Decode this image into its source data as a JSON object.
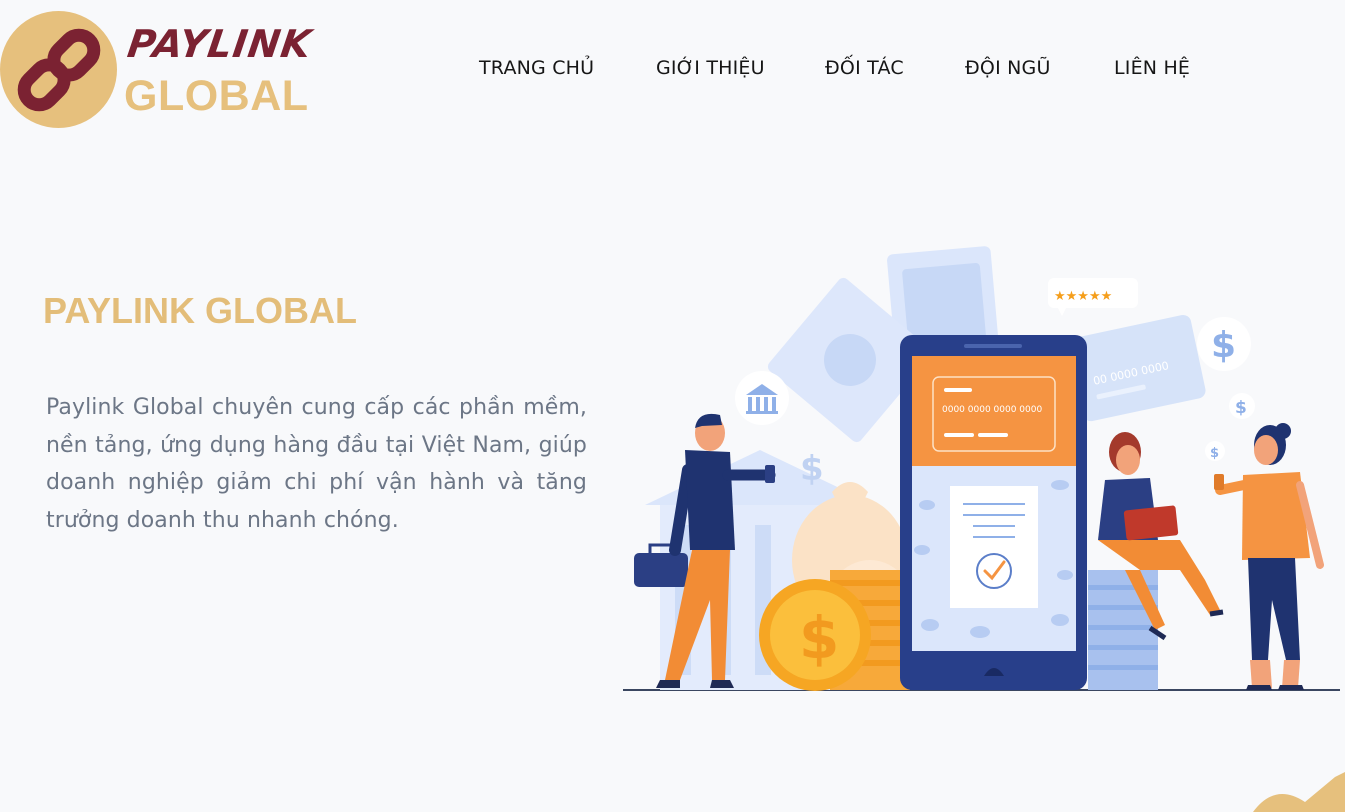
{
  "brand": {
    "logo_top": "PAYLINK",
    "logo_bottom": "GLOBAL",
    "colors": {
      "gold": "#e6c07d",
      "maroon": "#7b2232",
      "navy": "#1e3a7a",
      "orange": "#f59442"
    }
  },
  "nav": {
    "items": [
      {
        "label": "TRANG CHỦ"
      },
      {
        "label": "GIỚI THIỆU"
      },
      {
        "label": "ĐỐI TÁC"
      },
      {
        "label": "ĐỘI NGŨ"
      },
      {
        "label": "LIÊN HỆ"
      }
    ]
  },
  "hero": {
    "title": "PAYLINK GLOBAL",
    "description": "Paylink Global chuyên cung cấp các phần mềm, nền tảng, ứng dụng hàng đầu tại Việt Nam, giúp doanh nghiệp giảm chi phí vận hành và tăng trưởng doanh thu nhanh chóng."
  },
  "illustration": {
    "card_number": "0000 0000 0000 0000",
    "back_card_number": "00 0000 0000",
    "currency_symbol": "$",
    "rating_stars": 5
  }
}
